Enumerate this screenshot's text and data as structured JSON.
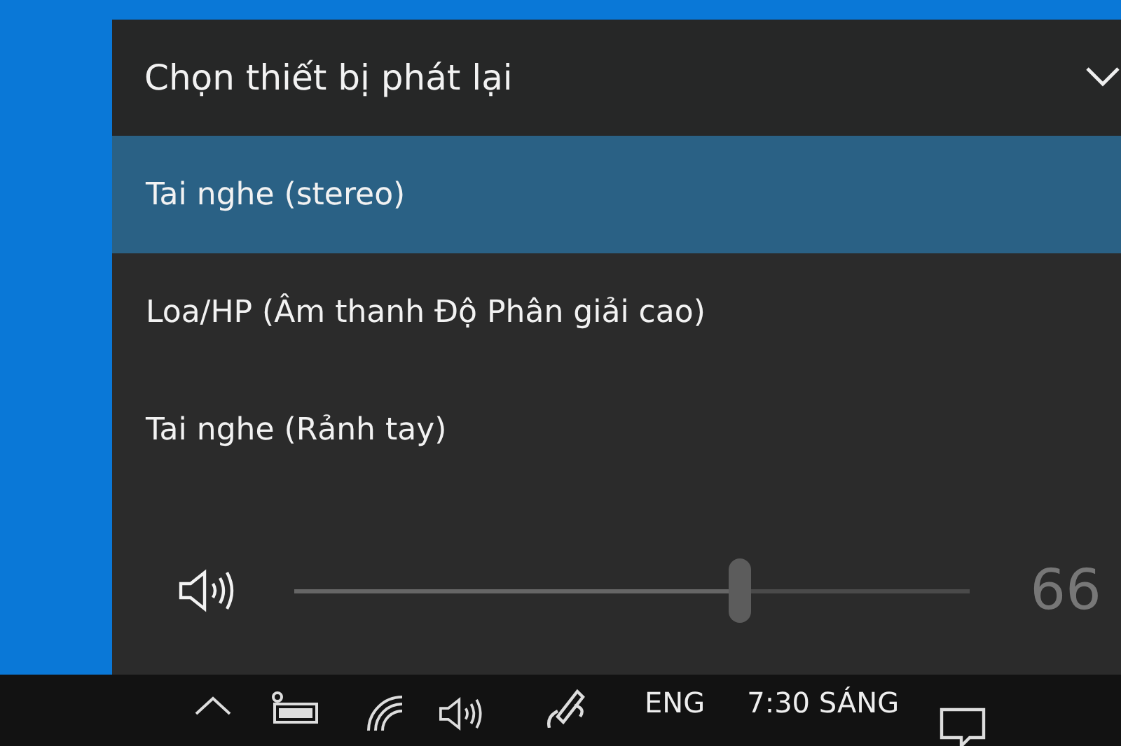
{
  "panel": {
    "title": "Chọn thiết bị phát lại",
    "expanded": true,
    "devices": [
      {
        "label": "Tai nghe (stereo)",
        "selected": true
      },
      {
        "label": "Loa/HP (Âm thanh Độ Phân giải cao)",
        "selected": false
      },
      {
        "label": "Tai nghe (Rảnh tay)",
        "selected": false
      }
    ],
    "volume": {
      "level": 0.66,
      "reading": "66",
      "disabled": true
    }
  },
  "taskbar": {
    "language": "ENG",
    "time": "7:30 SÁNG"
  }
}
